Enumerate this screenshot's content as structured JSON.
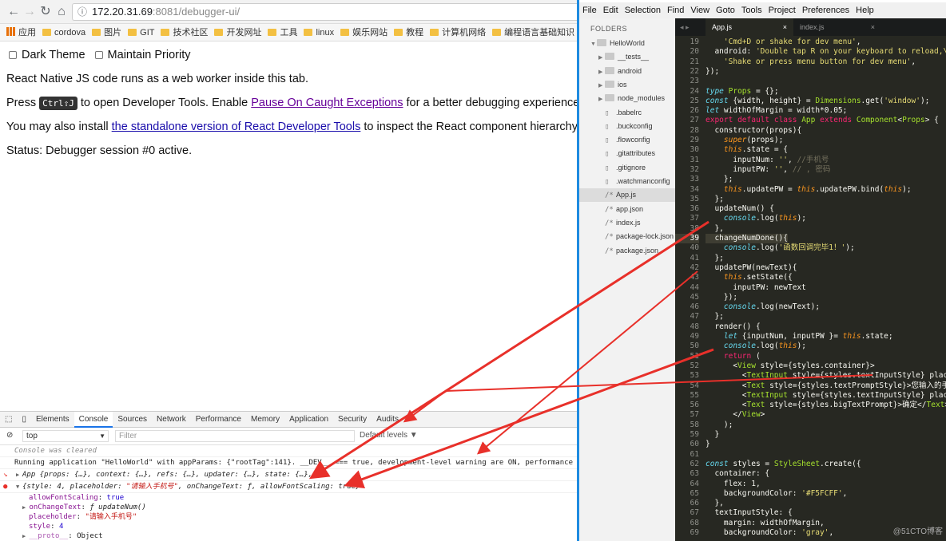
{
  "browser": {
    "url_host": "172.20.31.69",
    "url_rest": ":8081/debugger-ui/",
    "bookmarks": [
      "应用",
      "cordova",
      "图片",
      "GIT",
      "技术社区",
      "开发网址",
      "工具",
      "linux",
      "娱乐网站",
      "教程",
      "计算机网络",
      "编程语言基础知识"
    ],
    "page": {
      "dark_theme_label": "Dark Theme",
      "maintain_priority_label": "Maintain Priority",
      "line1": "React Native JS code runs as a web worker inside this tab.",
      "press_text": "Press",
      "shortcut": "Ctrl⇧J",
      "open_text": "to open Developer Tools. Enable",
      "pause_link": "Pause On Caught Exceptions",
      "better_text": "for a better debugging experience.",
      "install_text": "You may also install",
      "standalone_link": "the standalone version of React Developer Tools",
      "inspect_text": "to inspect the React component hierarchy, their",
      "status": "Status: Debugger session #0 active."
    }
  },
  "devtools": {
    "tabs": [
      "Elements",
      "Console",
      "Sources",
      "Network",
      "Performance",
      "Memory",
      "Application",
      "Security",
      "Audits"
    ],
    "active_tab": "Console",
    "context": "top",
    "filter_placeholder": "Filter",
    "levels": "Default levels ▼",
    "console": {
      "cleared": "Console was cleared",
      "running": "Running application \"HelloWorld\" with appParams: {\"rootTag\":141}. __DEV__ === true, development-level warning are ON, performance optimiza",
      "app_obj": "App {props: {…}, context: {…}, refs: {…}, updater: {…}, state: {…}, …}",
      "obj_start": "{style: 4, placeholder: ",
      "obj_placeholder": "\"请输入手机号\"",
      "obj_end": ", onChangeText: ƒ, allowFontScaling: true}",
      "prop1_key": "allowFontScaling",
      "prop1_val": "true",
      "prop2_key": "onChangeText",
      "prop2_val": "ƒ updateNum()",
      "prop3_key": "placeholder",
      "prop3_val": "\"请输入手机号\"",
      "prop4_key": "style",
      "prop4_val": "4",
      "proto_key": "__proto__",
      "proto_val": "Object"
    }
  },
  "editor": {
    "menu": [
      "File",
      "Edit",
      "Selection",
      "Find",
      "View",
      "Goto",
      "Tools",
      "Project",
      "Preferences",
      "Help"
    ],
    "folders_label": "FOLDERS",
    "tree": [
      {
        "name": "HelloWorld",
        "kind": "folder",
        "open": true,
        "depth": 0
      },
      {
        "name": "__tests__",
        "kind": "folder",
        "depth": 1
      },
      {
        "name": "android",
        "kind": "folder",
        "depth": 1
      },
      {
        "name": "ios",
        "kind": "folder",
        "depth": 1
      },
      {
        "name": "node_modules",
        "kind": "folder",
        "depth": 1
      },
      {
        "name": ".babelrc",
        "kind": "file",
        "depth": 1
      },
      {
        "name": ".buckconfig",
        "kind": "file",
        "depth": 1
      },
      {
        "name": ".flowconfig",
        "kind": "file",
        "depth": 1
      },
      {
        "name": ".gitattributes",
        "kind": "file",
        "depth": 1
      },
      {
        "name": ".gitignore",
        "kind": "file",
        "depth": 1
      },
      {
        "name": ".watchmanconfig",
        "kind": "file",
        "depth": 1
      },
      {
        "name": "App.js",
        "kind": "js",
        "depth": 1,
        "selected": true
      },
      {
        "name": "app.json",
        "kind": "js",
        "depth": 1
      },
      {
        "name": "index.js",
        "kind": "js",
        "depth": 1
      },
      {
        "name": "package-lock.json",
        "kind": "js",
        "depth": 1
      },
      {
        "name": "package.json",
        "kind": "js",
        "depth": 1
      }
    ],
    "tabs": [
      {
        "name": "App.js",
        "active": true
      },
      {
        "name": "index.js",
        "active": false
      }
    ],
    "highlight_line": 39,
    "code": [
      {
        "n": 19,
        "t": "    'Cmd+D or shake for dev menu',"
      },
      {
        "n": 20,
        "t": "  android: 'Double tap R on your keyboard to reload,\\n' +"
      },
      {
        "n": 21,
        "t": "    'Shake or press menu button for dev menu',"
      },
      {
        "n": 22,
        "t": "});"
      },
      {
        "n": 23,
        "t": ""
      },
      {
        "n": 24,
        "t": "type Props = {};"
      },
      {
        "n": 25,
        "t": "const {width, height} = Dimensions.get('window');"
      },
      {
        "n": 26,
        "t": "let widthOfMargin = width*0.05;"
      },
      {
        "n": 27,
        "t": "export default class App extends Component<Props> {"
      },
      {
        "n": 28,
        "t": "  constructor(props){"
      },
      {
        "n": 29,
        "t": "    super(props);"
      },
      {
        "n": 30,
        "t": "    this.state = {"
      },
      {
        "n": 31,
        "t": "      inputNum: '', //手机号"
      },
      {
        "n": 32,
        "t": "      inputPW: '', // , 密码"
      },
      {
        "n": 33,
        "t": "    };"
      },
      {
        "n": 34,
        "t": "    this.updatePW = this.updatePW.bind(this);"
      },
      {
        "n": 35,
        "t": "  };"
      },
      {
        "n": 36,
        "t": "  updateNum() {"
      },
      {
        "n": 37,
        "t": "    console.log(this);"
      },
      {
        "n": 38,
        "t": "  },"
      },
      {
        "n": 39,
        "t": "  changeNumDone(){"
      },
      {
        "n": 40,
        "t": "    console.log('函数回调完毕1！');"
      },
      {
        "n": 41,
        "t": "  };"
      },
      {
        "n": 42,
        "t": "  updatePW(newText){"
      },
      {
        "n": 43,
        "t": "    this.setState({"
      },
      {
        "n": 44,
        "t": "      inputPW: newText"
      },
      {
        "n": 45,
        "t": "    });"
      },
      {
        "n": 46,
        "t": "    console.log(newText);"
      },
      {
        "n": 47,
        "t": "  };"
      },
      {
        "n": 48,
        "t": "  render() {"
      },
      {
        "n": 49,
        "t": "    let {inputNum, inputPW }= this.state;"
      },
      {
        "n": 50,
        "t": "    console.log(this);"
      },
      {
        "n": 51,
        "t": "    return ("
      },
      {
        "n": 52,
        "t": "      <View style={styles.container}>"
      },
      {
        "n": 53,
        "t": "        <TextInput style={styles.textInputStyle} placeho"
      },
      {
        "n": 54,
        "t": "        <Text style={styles.textPromptStyle}>您输入的手机"
      },
      {
        "n": 55,
        "t": "        <TextInput style={styles.textInputStyle} placeho"
      },
      {
        "n": 56,
        "t": "        <Text style={styles.bigTextPrompt}>确定</Text>"
      },
      {
        "n": 57,
        "t": "      </View>"
      },
      {
        "n": 58,
        "t": "    );"
      },
      {
        "n": 59,
        "t": "  }"
      },
      {
        "n": 60,
        "t": "}"
      },
      {
        "n": 61,
        "t": ""
      },
      {
        "n": 62,
        "t": "const styles = StyleSheet.create({"
      },
      {
        "n": 63,
        "t": "  container: {"
      },
      {
        "n": 64,
        "t": "    flex: 1,"
      },
      {
        "n": 65,
        "t": "    backgroundColor: '#F5FCFF',"
      },
      {
        "n": 66,
        "t": "  },"
      },
      {
        "n": 67,
        "t": "  textInputStyle: {"
      },
      {
        "n": 68,
        "t": "    margin: widthOfMargin,"
      },
      {
        "n": 69,
        "t": "    backgroundColor: 'gray',"
      }
    ],
    "watermark": "@51CTO博客"
  },
  "colors": {
    "annotation_red": "#e8302a",
    "editor_bg": "#272822",
    "accent_blue": "#1e8be0"
  }
}
